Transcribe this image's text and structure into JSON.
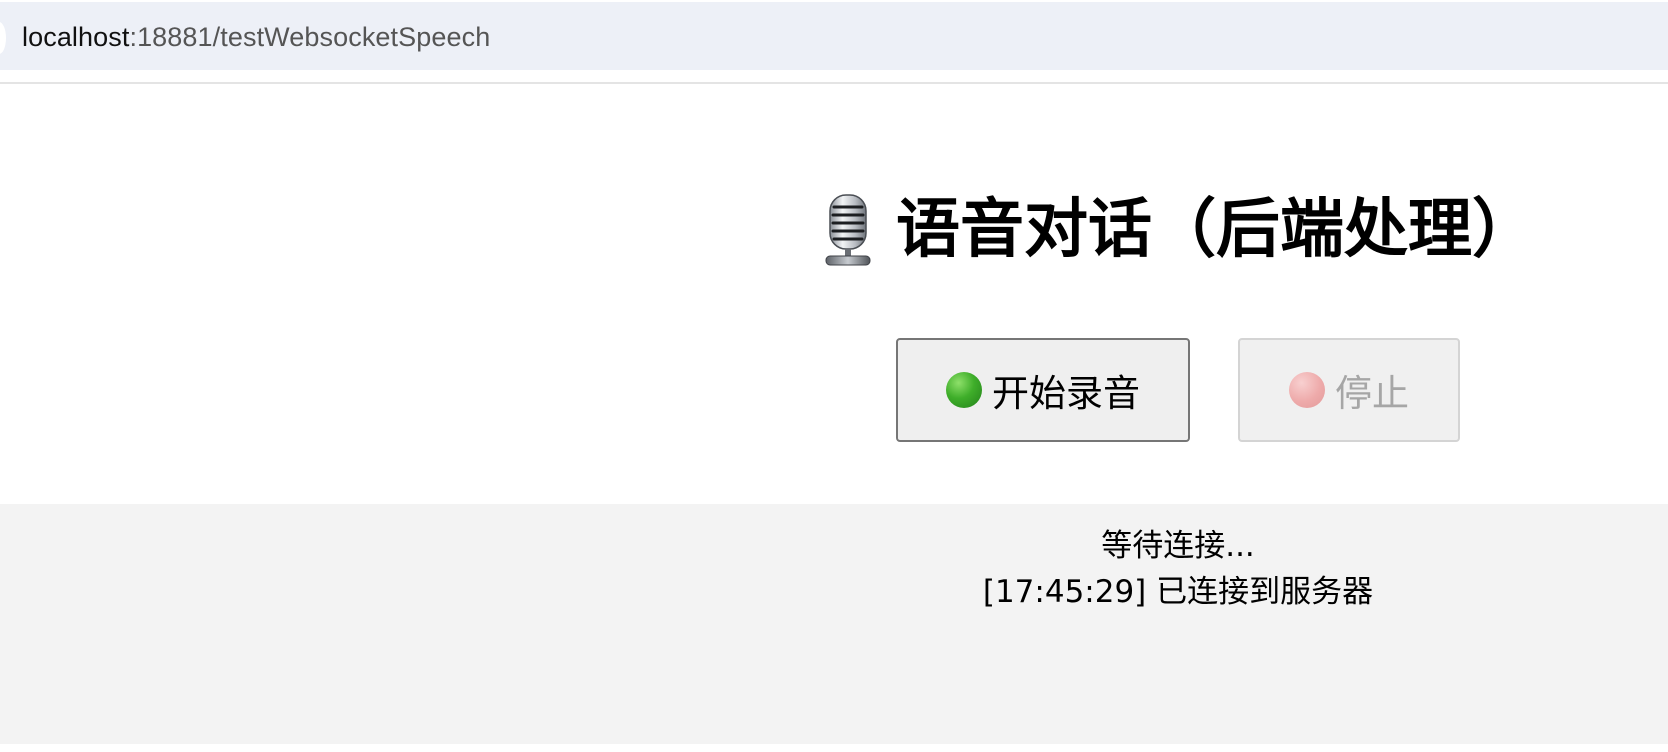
{
  "browser": {
    "url_host": "localhost",
    "url_rest": ":18881/testWebsocketSpeech"
  },
  "page": {
    "title": "语音对话（后端处理）",
    "title_icon": "studio-microphone-icon"
  },
  "controls": {
    "start_label": "开始录音",
    "start_icon": "green-circle-icon",
    "stop_label": "停止",
    "stop_icon": "red-circle-icon",
    "stop_disabled": true
  },
  "status": {
    "waiting_text": "等待连接...",
    "log": [
      "[17:45:29] 已连接到服务器"
    ]
  },
  "colors": {
    "start_dot": "#3fae2a",
    "stop_dot_disabled": "#eeaaaa",
    "status_background": "#f3f3f3",
    "address_bar_background": "#edf0f7"
  }
}
